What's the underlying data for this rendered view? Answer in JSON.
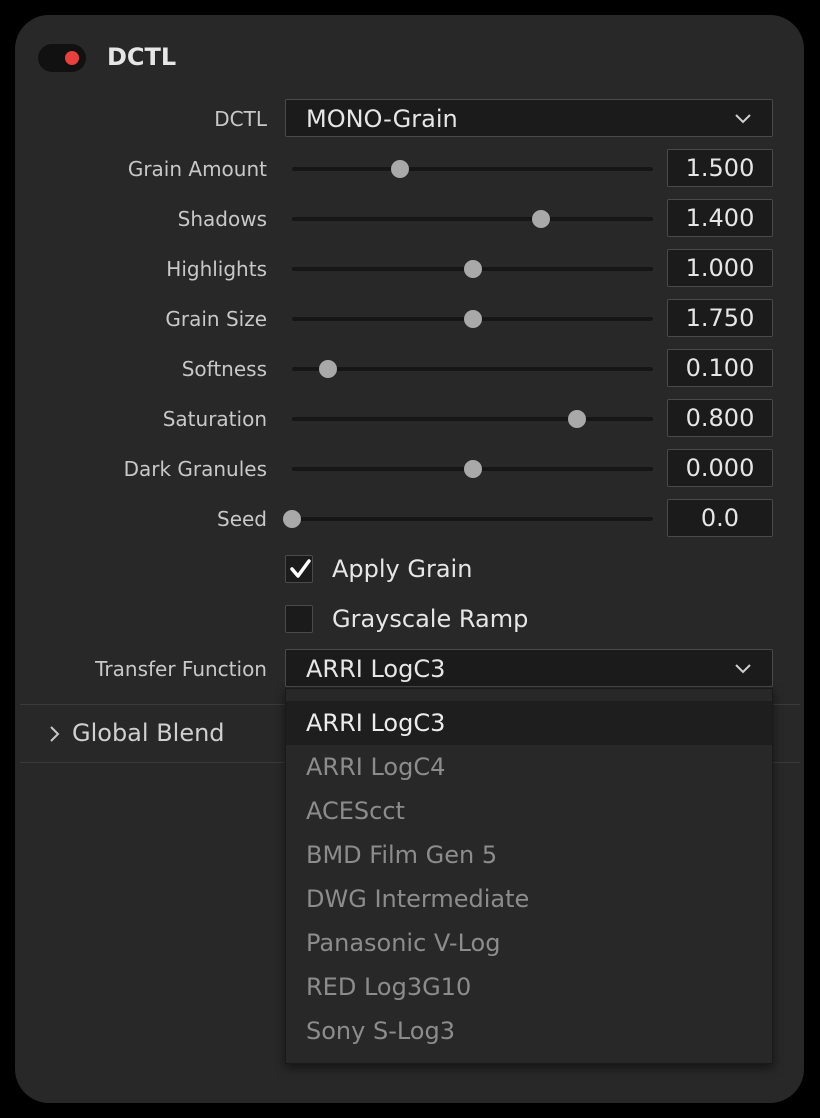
{
  "header": {
    "title": "DCTL",
    "enabled": true
  },
  "dctl_select": {
    "label": "DCTL",
    "value": "MONO-Grain"
  },
  "sliders": [
    {
      "label": "Grain Amount",
      "value": "1.500",
      "fraction": 0.3
    },
    {
      "label": "Shadows",
      "value": "1.400",
      "fraction": 0.69
    },
    {
      "label": "Highlights",
      "value": "1.000",
      "fraction": 0.5
    },
    {
      "label": "Grain Size",
      "value": "1.750",
      "fraction": 0.5
    },
    {
      "label": "Softness",
      "value": "0.100",
      "fraction": 0.1
    },
    {
      "label": "Saturation",
      "value": "0.800",
      "fraction": 0.79
    },
    {
      "label": "Dark Granules",
      "value": "0.000",
      "fraction": 0.5
    },
    {
      "label": "Seed",
      "value": "0.0",
      "fraction": 0.0
    }
  ],
  "checkboxes": [
    {
      "label": "Apply Grain",
      "checked": true
    },
    {
      "label": "Grayscale Ramp",
      "checked": false
    }
  ],
  "transfer": {
    "label": "Transfer Function",
    "value": "ARRI LogC3",
    "options": [
      "ARRI LogC3",
      "ARRI LogC4",
      "ACEScct",
      "BMD Film Gen 5",
      "DWG Intermediate",
      "Panasonic V-Log",
      "RED Log3G10",
      "Sony S-Log3"
    ],
    "selected_index": 0
  },
  "global_blend": {
    "label": "Global Blend"
  },
  "colors": {
    "panel": "#282828",
    "toggle_dot": "#e8403c",
    "field": "#1b1b1b",
    "thumb": "#a9a9a9"
  },
  "icons": {
    "dropdown": "chevron-down-icon",
    "section": "chevron-right-icon",
    "check": "checkmark-icon"
  }
}
